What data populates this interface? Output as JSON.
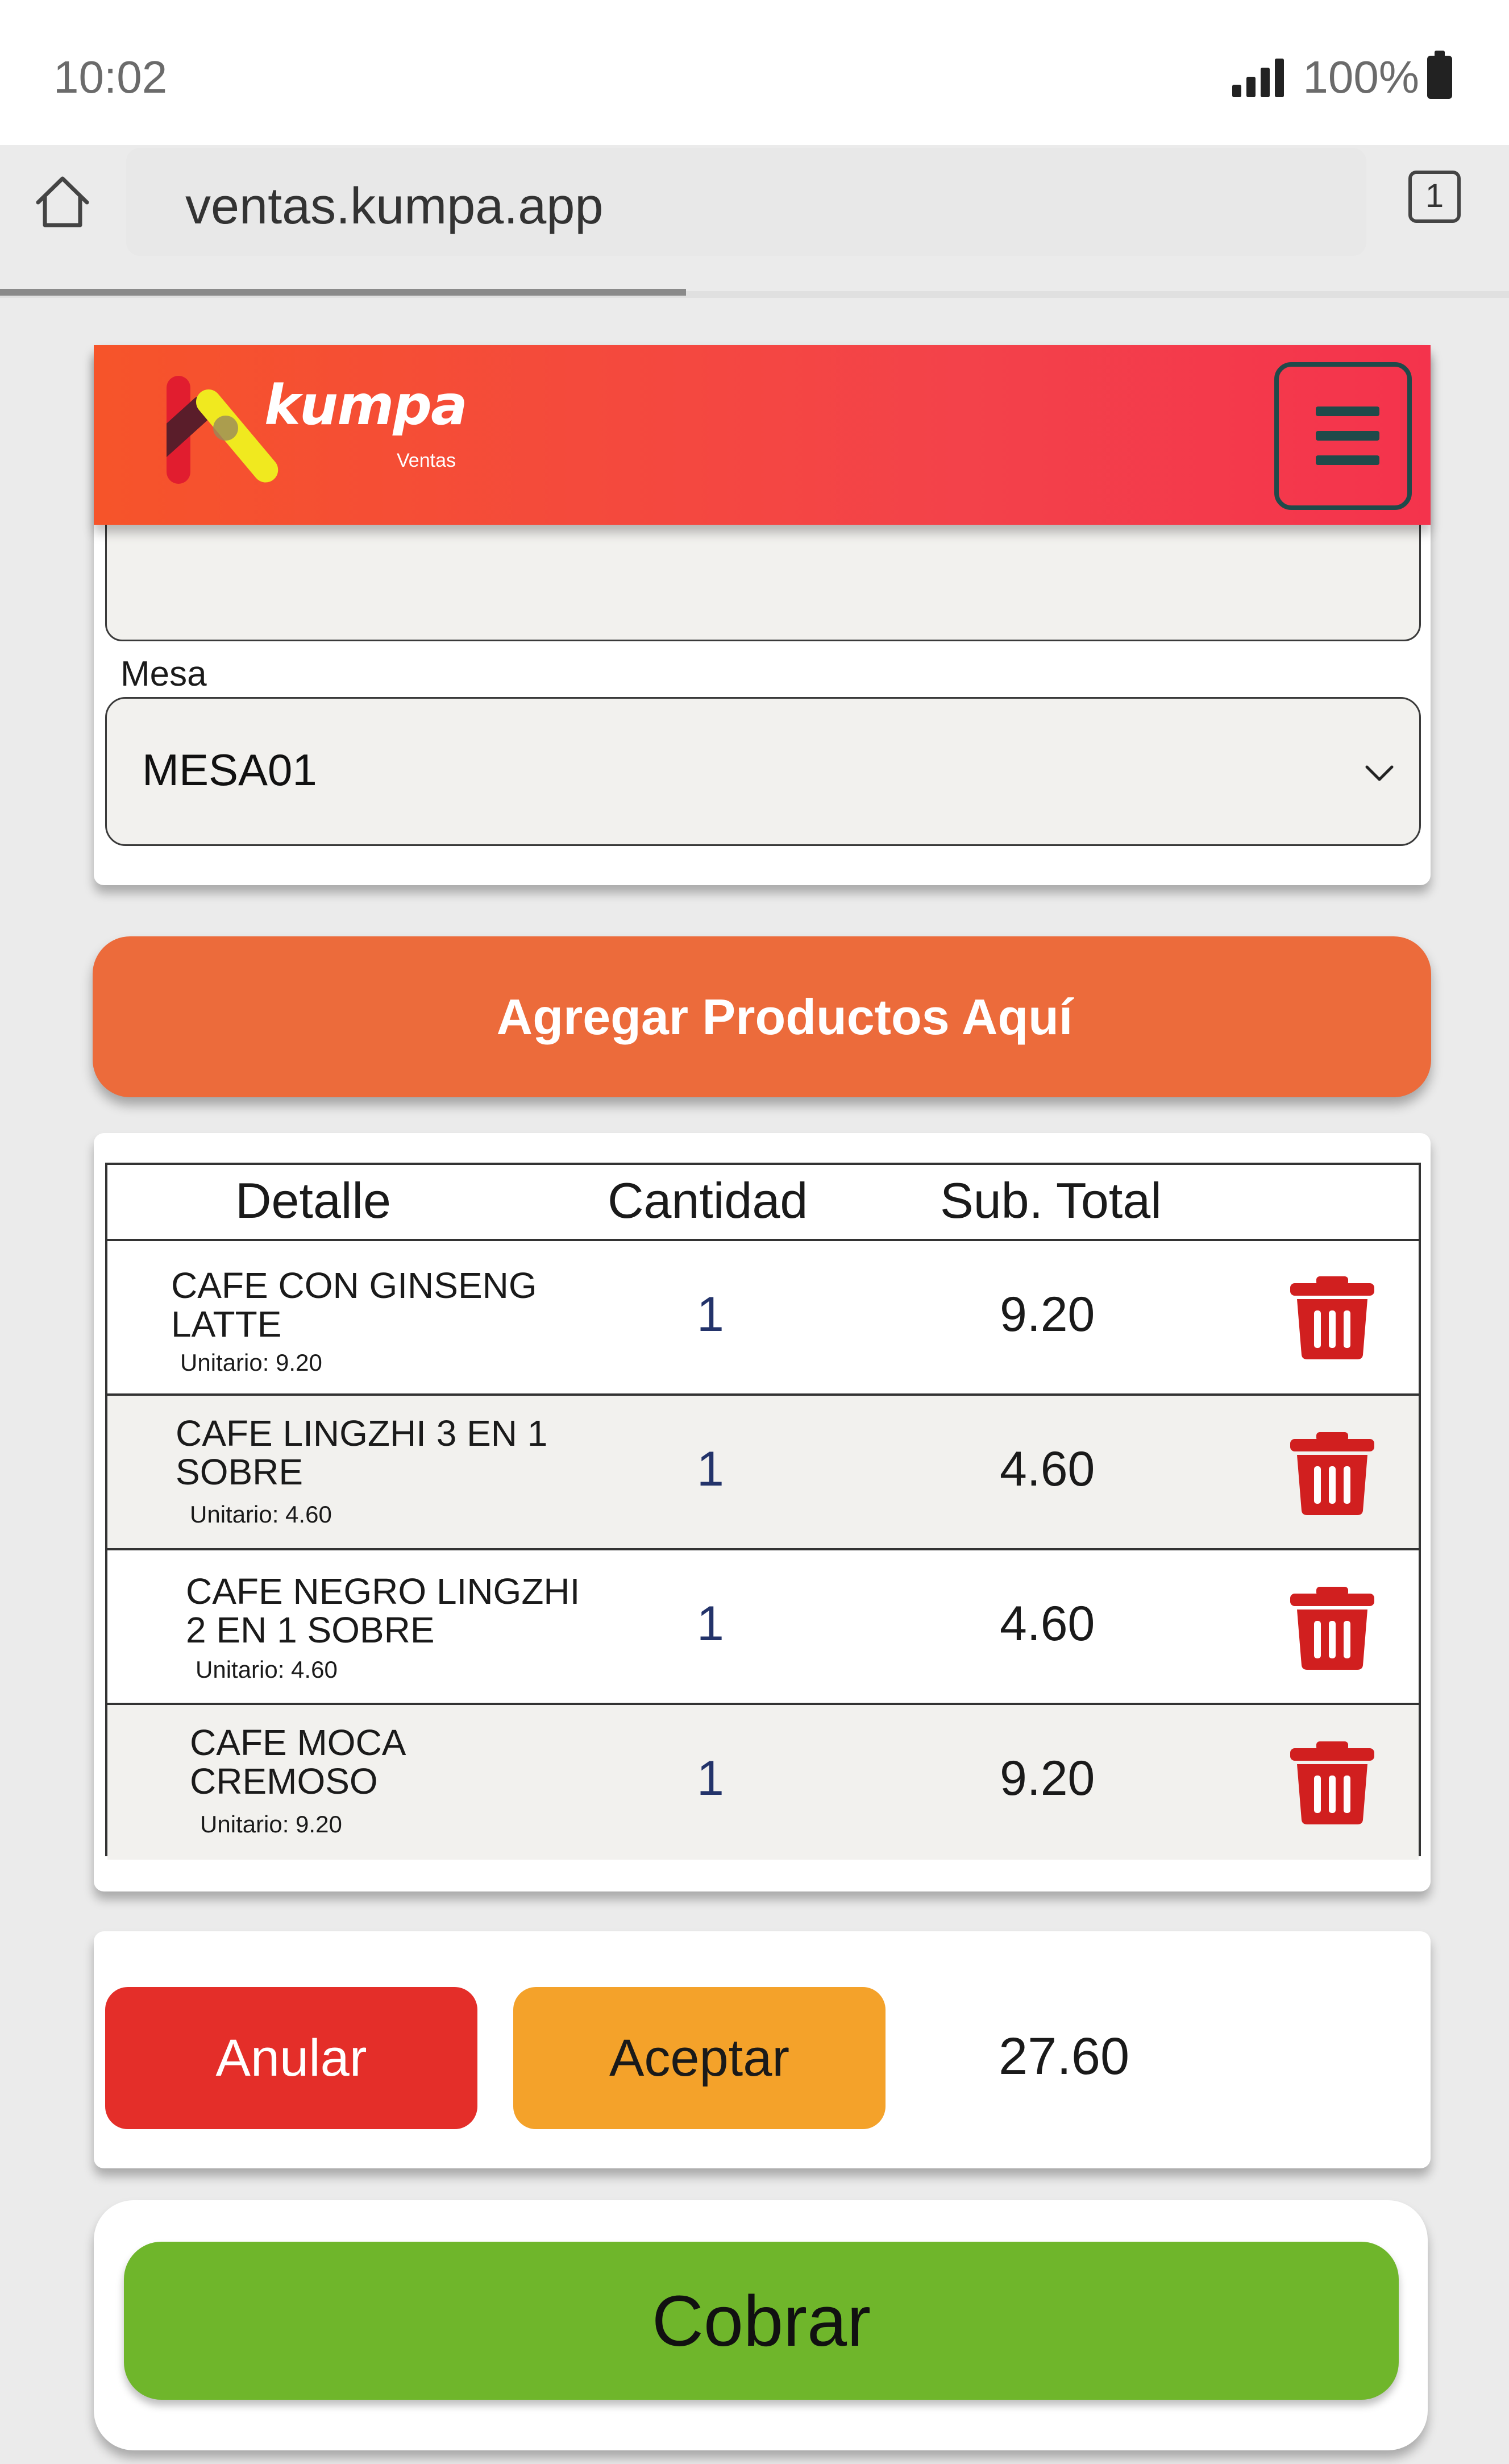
{
  "status_bar": {
    "time": "10:02",
    "battery": "100%"
  },
  "browser": {
    "url": "ventas.kumpa.app",
    "tab_count": "1"
  },
  "header": {
    "logo_text": "kumpa",
    "logo_subtitle": "Ventas",
    "menu_icon": "hamburger-menu-icon"
  },
  "form": {
    "mesa_label": "Mesa",
    "mesa_value": "MESA01"
  },
  "add_products_label": "Agregar Productos Aquí",
  "table": {
    "headers": {
      "detalle": "Detalle",
      "cantidad": "Cantidad",
      "subtotal": "Sub. Total"
    },
    "rows": [
      {
        "name": "CAFE CON GINSENG LATTE",
        "unit": "Unitario: 9.20",
        "qty": "1",
        "subtotal": "9.20"
      },
      {
        "name": "CAFE LINGZHI 3 EN 1 SOBRE",
        "unit": "Unitario: 4.60",
        "qty": "1",
        "subtotal": "4.60"
      },
      {
        "name": "CAFE NEGRO LINGZHI 2 EN 1 SOBRE",
        "unit": "Unitario: 4.60",
        "qty": "1",
        "subtotal": "4.60"
      },
      {
        "name": "CAFE MOCA CREMOSO",
        "unit": "Unitario: 9.20",
        "qty": "1",
        "subtotal": "9.20"
      }
    ]
  },
  "actions": {
    "anular_label": "Anular",
    "aceptar_label": "Aceptar",
    "total": "27.60"
  },
  "cobrar_label": "Cobrar",
  "colors": {
    "header_start": "#f6542a",
    "header_end": "#f4334c",
    "add_button": "#ec6b3b",
    "anular": "#e42e29",
    "aceptar": "#f4a22a",
    "cobrar": "#6fb62b",
    "trash": "#d11f1f",
    "quantity_text": "#23336a"
  }
}
